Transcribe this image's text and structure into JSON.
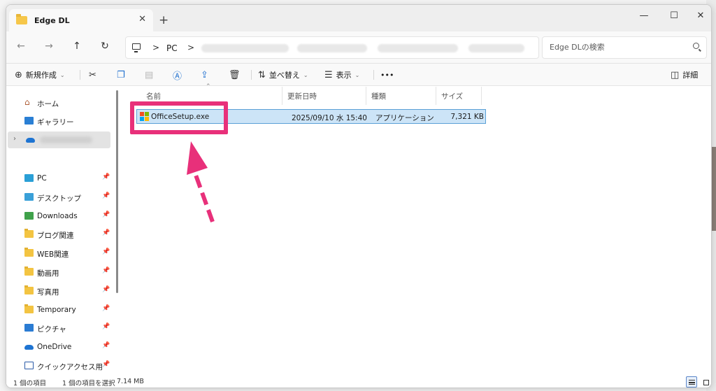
{
  "window": {
    "tab_title": "Edge DL",
    "tab_close": "✕",
    "new_tab": "+",
    "minimize": "—",
    "maximize": "☐",
    "close": "✕"
  },
  "nav": {
    "back": "←",
    "forward": "→",
    "up": "↑",
    "refresh": "↻"
  },
  "address": {
    "crumb_pc": "PC",
    "separator": ">"
  },
  "search": {
    "placeholder": "Edge DLの検索"
  },
  "toolbar": {
    "new_label": "新規作成",
    "sort_label": "並べ替え",
    "view_label": "表示",
    "more_label": "•••",
    "details_label": "詳細"
  },
  "sidebar": {
    "home": "ホーム",
    "gallery": "ギャラリー",
    "pinned": [
      {
        "label": "PC",
        "icon": "pc-icon"
      },
      {
        "label": "デスクトップ",
        "icon": "desktop-icon"
      },
      {
        "label": "Downloads",
        "icon": "downloads-icon"
      },
      {
        "label": "ブログ関連",
        "icon": "folder-icon"
      },
      {
        "label": "WEB関連",
        "icon": "folder-icon"
      },
      {
        "label": "動画用",
        "icon": "folder-icon"
      },
      {
        "label": "写真用",
        "icon": "folder-icon"
      },
      {
        "label": "Temporary",
        "icon": "folder-icon"
      },
      {
        "label": "ピクチャ",
        "icon": "pictures-icon"
      },
      {
        "label": "OneDrive",
        "icon": "onedrive-icon"
      },
      {
        "label": "クイックアクセス用",
        "icon": "quick-access-icon"
      }
    ]
  },
  "file_list": {
    "columns": [
      "名前",
      "更新日時",
      "種類",
      "サイズ"
    ],
    "rows": [
      {
        "name": "OfficeSetup.exe",
        "modified": "2025/09/10 水 15:40",
        "type": "アプリケーション",
        "size": "7,321 KB"
      }
    ]
  },
  "status": {
    "item_count": "1 個の項目",
    "selected": "1 個の項目を選択",
    "selected_size": "7.14 MB"
  },
  "colors": {
    "highlight": "#e8307a",
    "selection_bg": "#cce4f7",
    "selection_border": "#5aa0d6"
  }
}
